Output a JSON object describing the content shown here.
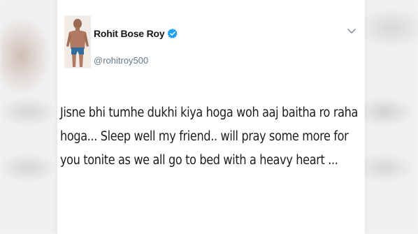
{
  "tweet": {
    "author": {
      "display_name": "Rohit Bose Roy",
      "handle": "@rohitroy500",
      "verified": true,
      "avatar_icon": "person-photo-avatar"
    },
    "menu_icon": "chevron-down-icon",
    "text_lines": [
      "Jisne bhi tumhe dukhi kiya hoga woh aaj baitha ro raha",
      "hoga... Sleep well my friend.. will pray some more for",
      "you tonite as we all go to bed with a heavy heart ..."
    ]
  },
  "colors": {
    "verified_blue": "#1da1f2",
    "name_text": "#14171a",
    "handle_text": "#657786",
    "body_text": "#1c1c1c"
  }
}
